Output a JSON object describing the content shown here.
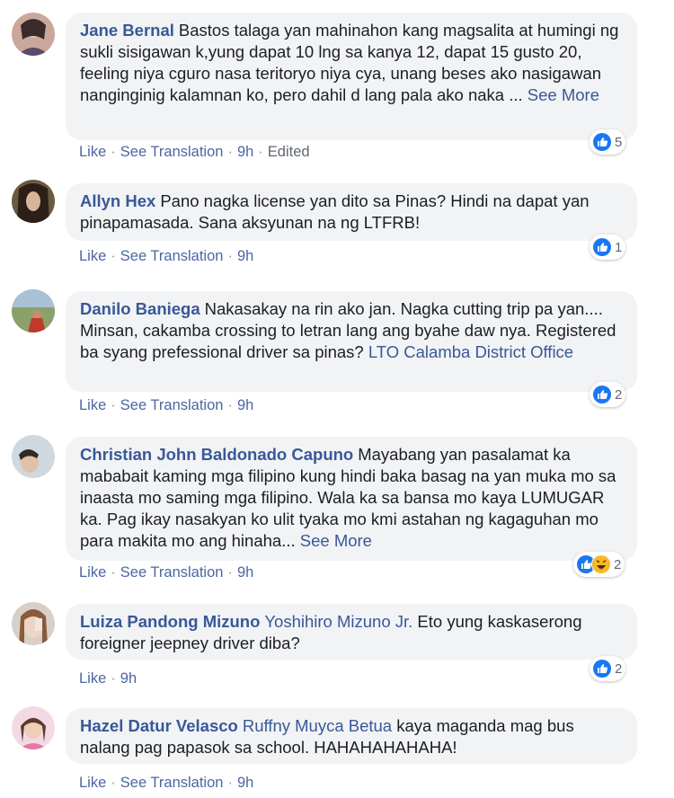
{
  "comments": [
    {
      "author": "Jane Bernal",
      "text": "Bastos talaga yan mahinahon kang magsalita at humingi ng sukli sisigawan k,yung dapat 10 lng sa kanya 12, dapat 15 gusto 20, feeling niya cguro nasa teritoryo niya cya, unang beses ako nasigawan nanginginig kalamnan ko, pero dahil d lang pala ako naka ...",
      "see_more": "See More",
      "reaction_count": "5",
      "like": "Like",
      "translate": "See Translation",
      "time": "9h",
      "edited": "Edited"
    },
    {
      "author": "Allyn Hex",
      "text": "Pano nagka license yan dito sa Pinas? Hindi na dapat yan pinapamasada. Sana aksyunan na ng LTFRB!",
      "reaction_count": "1",
      "like": "Like",
      "translate": "See Translation",
      "time": "9h"
    },
    {
      "author": "Danilo Baniega",
      "text": "Nakasakay na rin ako jan. Nagka cutting trip pa yan.... Minsan, cakamba crossing to letran lang ang byahe daw nya. Registered ba syang prefessional driver sa pinas?",
      "mention": "LTO Calamba District Office",
      "reaction_count": "2",
      "like": "Like",
      "translate": "See Translation",
      "time": "9h"
    },
    {
      "author": "Christian John Baldonado Capuno",
      "text": "Mayabang yan pasalamat ka mababait kaming mga filipino kung hindi baka basag na yan muka mo sa inaasta mo saming mga filipino. Wala ka sa bansa mo kaya LUMUGAR ka. Pag ikay nasakyan ko ulit tyaka mo kmi astahan ng kagaguhan mo para makita mo ang hinaha...",
      "see_more": "See More",
      "reaction_count": "2",
      "like": "Like",
      "translate": "See Translation",
      "time": "9h"
    },
    {
      "author": "Luiza Pandong Mizuno",
      "mention": "Yoshihiro Mizuno Jr.",
      "text": "Eto yung kaskaserong foreigner jeepney driver diba?",
      "reaction_count": "2",
      "like": "Like",
      "time": "9h"
    },
    {
      "author": "Hazel Datur Velasco",
      "mention": "Ruffny Muyca Betua",
      "text": "kaya maganda mag bus nalang pag papasok sa school. HAHAHAHAHAHA!",
      "like": "Like",
      "translate": "See Translation",
      "time": "9h"
    }
  ],
  "colors": {
    "link": "#385898",
    "bubble": "#f2f3f5",
    "like_blue": "#1877f2",
    "haha_yellow": "#f7b928",
    "meta_gray": "#606770"
  },
  "icons": {
    "like_reaction": "thumbs-up-icon",
    "haha_reaction": "haha-emoji-icon",
    "avatar": "profile-photo"
  }
}
